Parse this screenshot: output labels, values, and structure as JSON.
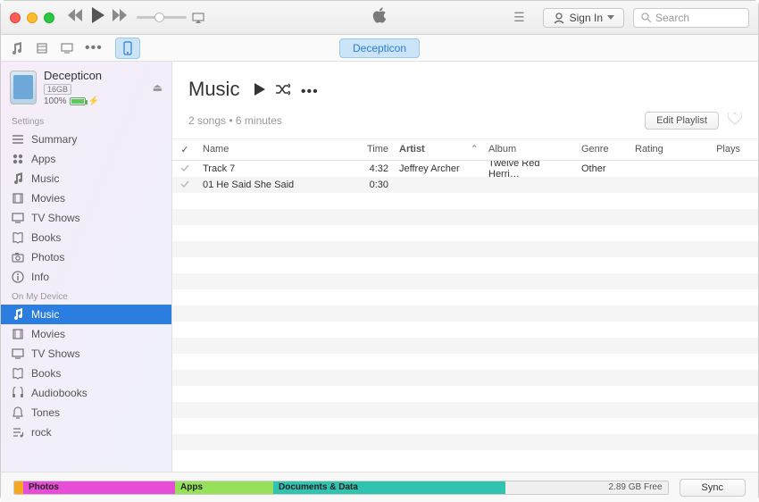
{
  "header": {
    "signin_label": "Sign In",
    "search_placeholder": "Search"
  },
  "subbar": {
    "tab_label": "Decepticon"
  },
  "device": {
    "name": "Decepticon",
    "capacity": "16GB",
    "battery_pct": "100%"
  },
  "sidebar": {
    "section_settings": "Settings",
    "settings": [
      {
        "id": "summary",
        "label": "Summary",
        "icon": "list-icon"
      },
      {
        "id": "apps",
        "label": "Apps",
        "icon": "apps-icon"
      },
      {
        "id": "music",
        "label": "Music",
        "icon": "music-icon"
      },
      {
        "id": "movies",
        "label": "Movies",
        "icon": "film-icon"
      },
      {
        "id": "tvshows",
        "label": "TV Shows",
        "icon": "tv-icon"
      },
      {
        "id": "books",
        "label": "Books",
        "icon": "book-icon"
      },
      {
        "id": "photos",
        "label": "Photos",
        "icon": "camera-icon"
      },
      {
        "id": "info",
        "label": "Info",
        "icon": "info-icon"
      }
    ],
    "section_device": "On My Device",
    "ondevice": [
      {
        "id": "d-music",
        "label": "Music",
        "icon": "music-icon",
        "selected": true
      },
      {
        "id": "d-movies",
        "label": "Movies",
        "icon": "film-icon"
      },
      {
        "id": "d-tvshows",
        "label": "TV Shows",
        "icon": "tv-icon"
      },
      {
        "id": "d-books",
        "label": "Books",
        "icon": "book-icon"
      },
      {
        "id": "d-audiobooks",
        "label": "Audiobooks",
        "icon": "audiobook-icon"
      },
      {
        "id": "d-tones",
        "label": "Tones",
        "icon": "bell-icon"
      },
      {
        "id": "d-rock",
        "label": "rock",
        "icon": "playlist-icon"
      }
    ]
  },
  "content": {
    "title": "Music",
    "subinfo": "2 songs • 6 minutes",
    "edit_label": "Edit Playlist",
    "columns": {
      "name": "Name",
      "time": "Time",
      "artist": "Artist",
      "album": "Album",
      "genre": "Genre",
      "rating": "Rating",
      "plays": "Plays"
    },
    "rows": [
      {
        "checked": true,
        "name": "Track 7",
        "time": "4:32",
        "artist": "Jeffrey Archer",
        "album": "Twelve Red Herri…",
        "genre": "Other",
        "rating": "",
        "plays": ""
      },
      {
        "checked": true,
        "name": "01 He Said She Said",
        "time": "0:30",
        "artist": "",
        "album": "",
        "genre": "",
        "rating": "",
        "plays": ""
      }
    ]
  },
  "storage": {
    "photos": "Photos",
    "apps": "Apps",
    "docs": "Documents & Data",
    "free": "2.89 GB Free"
  },
  "sync_label": "Sync"
}
